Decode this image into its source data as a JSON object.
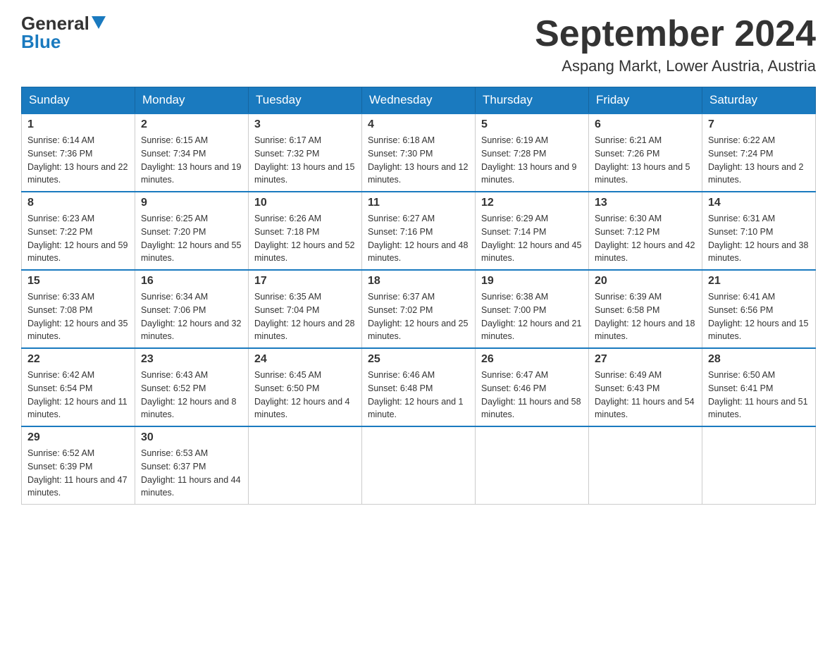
{
  "header": {
    "logo_general": "General",
    "logo_blue": "Blue",
    "month_title": "September 2024",
    "location": "Aspang Markt, Lower Austria, Austria"
  },
  "weekdays": [
    "Sunday",
    "Monday",
    "Tuesday",
    "Wednesday",
    "Thursday",
    "Friday",
    "Saturday"
  ],
  "weeks": [
    [
      {
        "day": "1",
        "sunrise": "6:14 AM",
        "sunset": "7:36 PM",
        "daylight": "13 hours and 22 minutes."
      },
      {
        "day": "2",
        "sunrise": "6:15 AM",
        "sunset": "7:34 PM",
        "daylight": "13 hours and 19 minutes."
      },
      {
        "day": "3",
        "sunrise": "6:17 AM",
        "sunset": "7:32 PM",
        "daylight": "13 hours and 15 minutes."
      },
      {
        "day": "4",
        "sunrise": "6:18 AM",
        "sunset": "7:30 PM",
        "daylight": "13 hours and 12 minutes."
      },
      {
        "day": "5",
        "sunrise": "6:19 AM",
        "sunset": "7:28 PM",
        "daylight": "13 hours and 9 minutes."
      },
      {
        "day": "6",
        "sunrise": "6:21 AM",
        "sunset": "7:26 PM",
        "daylight": "13 hours and 5 minutes."
      },
      {
        "day": "7",
        "sunrise": "6:22 AM",
        "sunset": "7:24 PM",
        "daylight": "13 hours and 2 minutes."
      }
    ],
    [
      {
        "day": "8",
        "sunrise": "6:23 AM",
        "sunset": "7:22 PM",
        "daylight": "12 hours and 59 minutes."
      },
      {
        "day": "9",
        "sunrise": "6:25 AM",
        "sunset": "7:20 PM",
        "daylight": "12 hours and 55 minutes."
      },
      {
        "day": "10",
        "sunrise": "6:26 AM",
        "sunset": "7:18 PM",
        "daylight": "12 hours and 52 minutes."
      },
      {
        "day": "11",
        "sunrise": "6:27 AM",
        "sunset": "7:16 PM",
        "daylight": "12 hours and 48 minutes."
      },
      {
        "day": "12",
        "sunrise": "6:29 AM",
        "sunset": "7:14 PM",
        "daylight": "12 hours and 45 minutes."
      },
      {
        "day": "13",
        "sunrise": "6:30 AM",
        "sunset": "7:12 PM",
        "daylight": "12 hours and 42 minutes."
      },
      {
        "day": "14",
        "sunrise": "6:31 AM",
        "sunset": "7:10 PM",
        "daylight": "12 hours and 38 minutes."
      }
    ],
    [
      {
        "day": "15",
        "sunrise": "6:33 AM",
        "sunset": "7:08 PM",
        "daylight": "12 hours and 35 minutes."
      },
      {
        "day": "16",
        "sunrise": "6:34 AM",
        "sunset": "7:06 PM",
        "daylight": "12 hours and 32 minutes."
      },
      {
        "day": "17",
        "sunrise": "6:35 AM",
        "sunset": "7:04 PM",
        "daylight": "12 hours and 28 minutes."
      },
      {
        "day": "18",
        "sunrise": "6:37 AM",
        "sunset": "7:02 PM",
        "daylight": "12 hours and 25 minutes."
      },
      {
        "day": "19",
        "sunrise": "6:38 AM",
        "sunset": "7:00 PM",
        "daylight": "12 hours and 21 minutes."
      },
      {
        "day": "20",
        "sunrise": "6:39 AM",
        "sunset": "6:58 PM",
        "daylight": "12 hours and 18 minutes."
      },
      {
        "day": "21",
        "sunrise": "6:41 AM",
        "sunset": "6:56 PM",
        "daylight": "12 hours and 15 minutes."
      }
    ],
    [
      {
        "day": "22",
        "sunrise": "6:42 AM",
        "sunset": "6:54 PM",
        "daylight": "12 hours and 11 minutes."
      },
      {
        "day": "23",
        "sunrise": "6:43 AM",
        "sunset": "6:52 PM",
        "daylight": "12 hours and 8 minutes."
      },
      {
        "day": "24",
        "sunrise": "6:45 AM",
        "sunset": "6:50 PM",
        "daylight": "12 hours and 4 minutes."
      },
      {
        "day": "25",
        "sunrise": "6:46 AM",
        "sunset": "6:48 PM",
        "daylight": "12 hours and 1 minute."
      },
      {
        "day": "26",
        "sunrise": "6:47 AM",
        "sunset": "6:46 PM",
        "daylight": "11 hours and 58 minutes."
      },
      {
        "day": "27",
        "sunrise": "6:49 AM",
        "sunset": "6:43 PM",
        "daylight": "11 hours and 54 minutes."
      },
      {
        "day": "28",
        "sunrise": "6:50 AM",
        "sunset": "6:41 PM",
        "daylight": "11 hours and 51 minutes."
      }
    ],
    [
      {
        "day": "29",
        "sunrise": "6:52 AM",
        "sunset": "6:39 PM",
        "daylight": "11 hours and 47 minutes."
      },
      {
        "day": "30",
        "sunrise": "6:53 AM",
        "sunset": "6:37 PM",
        "daylight": "11 hours and 44 minutes."
      },
      null,
      null,
      null,
      null,
      null
    ]
  ],
  "labels": {
    "sunrise": "Sunrise: ",
    "sunset": "Sunset: ",
    "daylight": "Daylight: "
  }
}
